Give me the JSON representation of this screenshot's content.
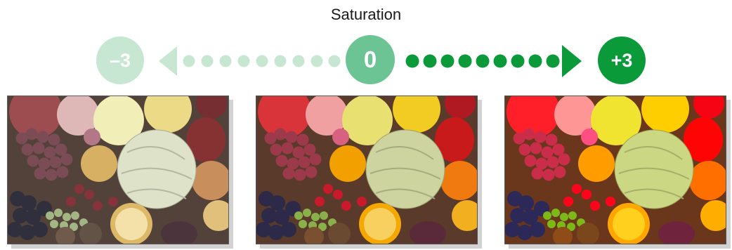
{
  "title": "Saturation",
  "scale": {
    "min_label": "–3",
    "zero_label": "0",
    "max_label": "+3",
    "colors": {
      "light": "#c7e7d2",
      "mid": "#6cc394",
      "strong": "#0a9a3a"
    }
  },
  "photos": [
    {
      "name": "fruit-photo-low-saturation",
      "saturation": -3,
      "icon": "fruit-photo"
    },
    {
      "name": "fruit-photo-normal-saturation",
      "saturation": 0,
      "icon": "fruit-photo"
    },
    {
      "name": "fruit-photo-high-saturation",
      "saturation": 3,
      "icon": "fruit-photo"
    }
  ]
}
